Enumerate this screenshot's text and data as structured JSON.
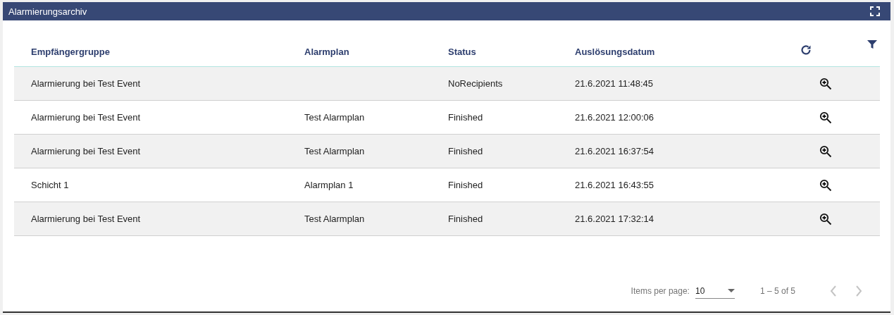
{
  "panel": {
    "title": "Alarmierungsarchiv"
  },
  "table": {
    "columns": [
      "Empfängergruppe",
      "Alarmplan",
      "Status",
      "Auslösungsdatum"
    ],
    "rows": [
      {
        "cells": [
          "Alarmierung bei Test Event",
          "",
          "NoRecipients",
          "21.6.2021 11:48:45"
        ]
      },
      {
        "cells": [
          "Alarmierung bei Test Event",
          "Test Alarmplan",
          "Finished",
          "21.6.2021 12:00:06"
        ]
      },
      {
        "cells": [
          "Alarmierung bei Test Event",
          "Test Alarmplan",
          "Finished",
          "21.6.2021 16:37:54"
        ]
      },
      {
        "cells": [
          "Schicht 1",
          "Alarmplan 1",
          "Finished",
          "21.6.2021 16:43:55"
        ]
      },
      {
        "cells": [
          "Alarmierung bei Test Event",
          "Test Alarmplan",
          "Finished",
          "21.6.2021 17:32:14"
        ]
      }
    ]
  },
  "paginator": {
    "label": "Items per page:",
    "page_size": "10",
    "range": "1 – 5 of 5",
    "previous_disabled": true,
    "next_disabled": true
  }
}
